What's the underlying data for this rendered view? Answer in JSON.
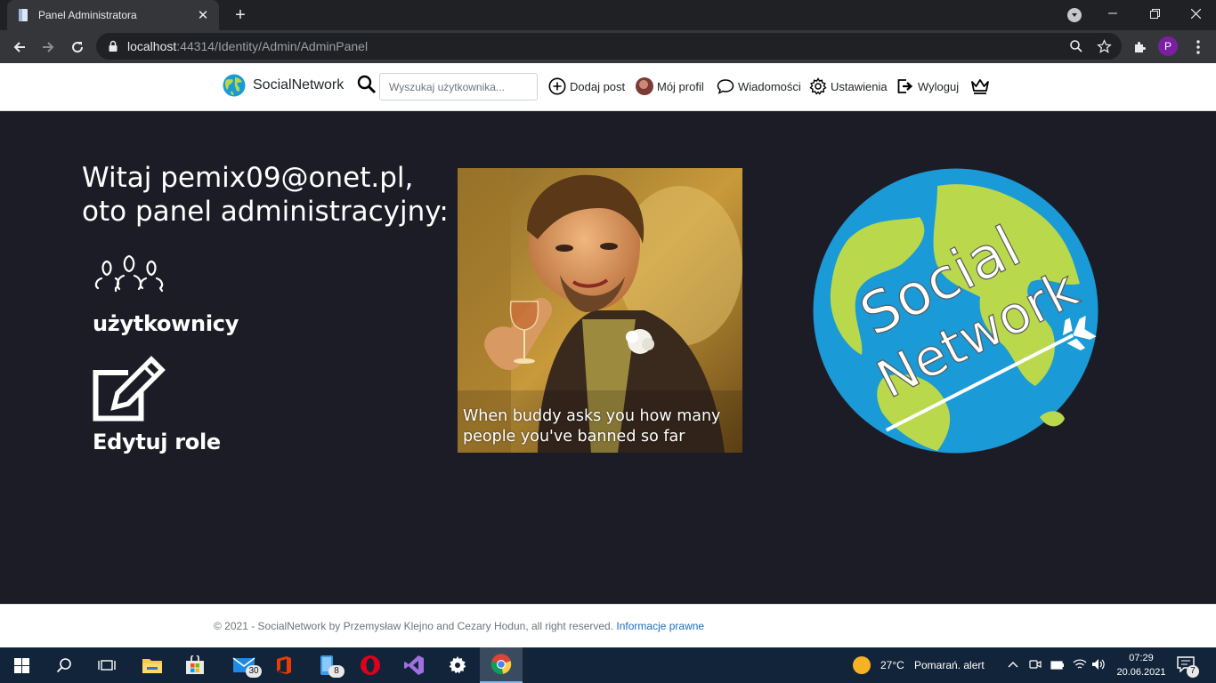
{
  "browser": {
    "tab_title": "Panel Administratora",
    "url_host": "localhost",
    "url_path": ":44314/Identity/Admin/AdminPanel",
    "profile_initial": "P"
  },
  "nav": {
    "brand": "SocialNetwork",
    "search_placeholder": "Wyszukaj użytkownika...",
    "add_post": "Dodaj post",
    "my_profile": "Mój profil",
    "messages": "Wiadomości",
    "settings": "Ustawienia",
    "logout": "Wyloguj"
  },
  "main": {
    "greeting_line1": "Witaj pemix09@onet.pl,",
    "greeting_line2": "oto panel administracyjny:",
    "users_label": "użytkownicy",
    "edit_roles_label": "Edytuj role",
    "meme_caption_line1": "When buddy asks you how many",
    "meme_caption_line2": "people you've banned so far",
    "logo_text_1": "Social",
    "logo_text_2": "Network"
  },
  "footer": {
    "text": "© 2021 - SocialNetwork by Przemysław Klejno and Cezary Hodun, all right reserved.",
    "link": "Informacje prawne"
  },
  "taskbar": {
    "mail_badge": "30",
    "phone_badge": "8",
    "weather_temp": "27°C",
    "weather_text": "Pomarań. alert",
    "time": "07:29",
    "date": "20.06.2021",
    "notification_count": "7"
  }
}
